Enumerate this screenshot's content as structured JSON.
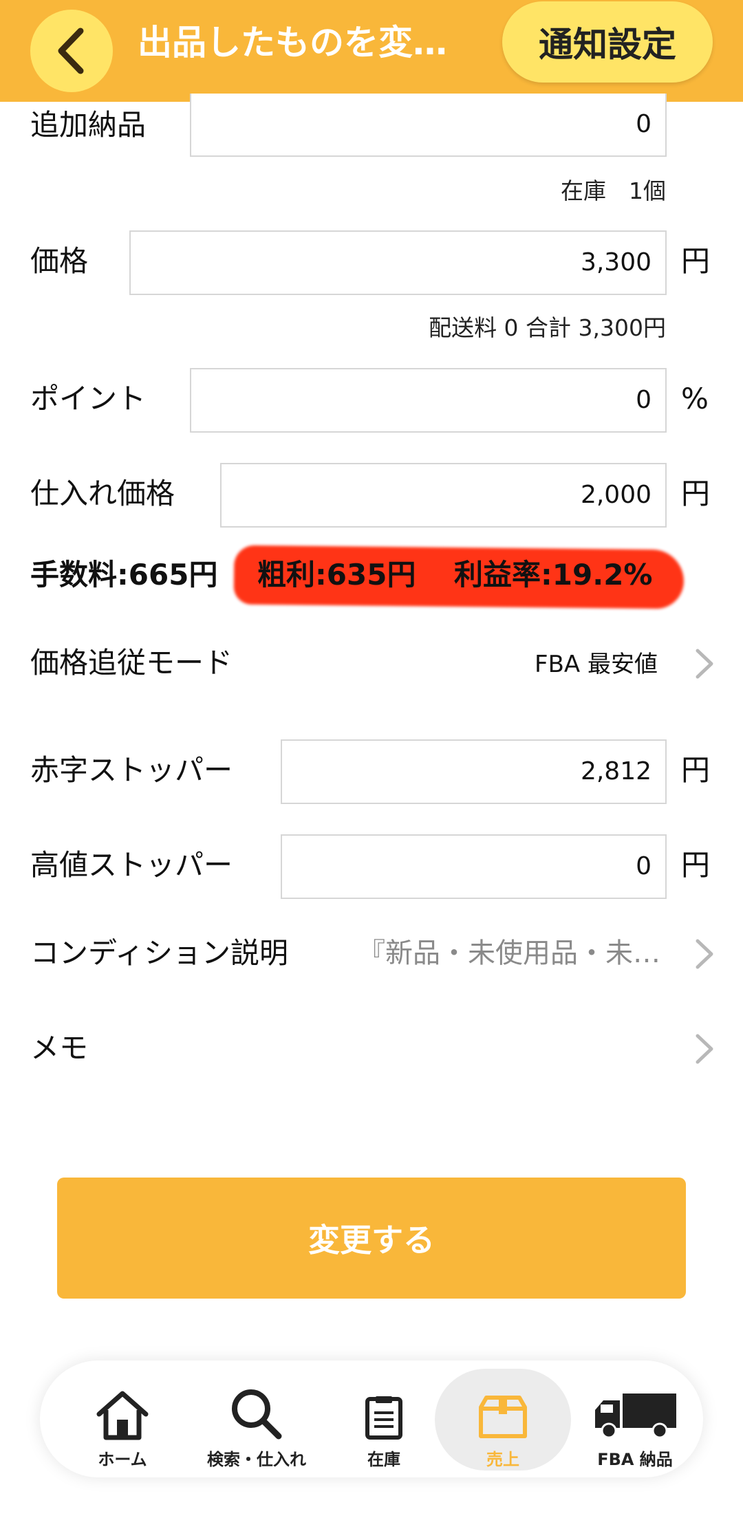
{
  "header": {
    "title": "出品したものを変…",
    "notify_label": "通知設定"
  },
  "form": {
    "additional_delivery": {
      "label": "追加納品",
      "value": "0"
    },
    "stock_note": "在庫　1個",
    "price": {
      "label": "価格",
      "value": "3,300",
      "unit": "円"
    },
    "shipping_note": "配送料 0  合計 3,300円",
    "points": {
      "label": "ポイント",
      "value": "0",
      "unit": "%"
    },
    "purchase_price": {
      "label": "仕入れ価格",
      "value": "2,000",
      "unit": "円"
    },
    "fee": "手数料:665円",
    "gross_profit": "粗利:635円",
    "profit_rate": "利益率:19.2%",
    "price_tracking": {
      "label": "価格追従モード",
      "value": "FBA 最安値"
    },
    "loss_stopper": {
      "label": "赤字ストッパー",
      "value": "2,812",
      "unit": "円"
    },
    "high_stopper": {
      "label": "高値ストッパー",
      "value": "0",
      "unit": "円"
    },
    "condition": {
      "label": "コンディション説明",
      "value": "『新品・未使用品・未…"
    },
    "memo": {
      "label": "メモ"
    }
  },
  "submit_label": "変更する",
  "nav": {
    "home": "ホーム",
    "search": "検索・仕入れ",
    "stock": "在庫",
    "sales": "売上",
    "fba": "FBA 納品"
  },
  "colors": {
    "accent": "#f9b73a",
    "button_yellow": "#ffe466",
    "highlight_red": "#ff2a0a"
  }
}
